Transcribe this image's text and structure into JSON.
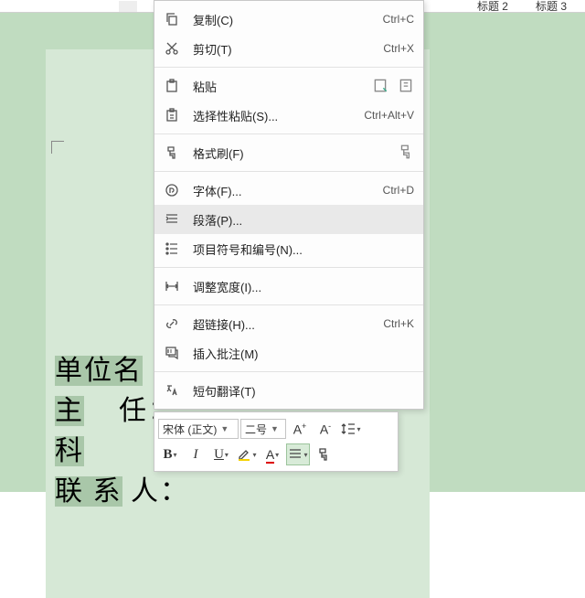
{
  "ribbon": {
    "styles": [
      "标题 2",
      "标题 3"
    ]
  },
  "document": {
    "lines": [
      {
        "highlighted": "单位名",
        "rest": ""
      },
      {
        "highlighted": "主",
        "rest": "    任："
      },
      {
        "highlighted": "科",
        "rest": ""
      },
      {
        "highlighted": "联 系",
        "rest": " 人："
      }
    ]
  },
  "contextMenu": {
    "items": [
      {
        "icon": "copy",
        "label": "复制(C)",
        "shortcut": "Ctrl+C"
      },
      {
        "icon": "cut",
        "label": "剪切(T)",
        "shortcut": "Ctrl+X"
      },
      {
        "sep": true
      },
      {
        "icon": "paste",
        "label": "粘贴",
        "shortcut": "",
        "rightIcons": [
          "paste-opt1",
          "paste-opt2"
        ]
      },
      {
        "icon": "paste-sp",
        "label": "选择性粘贴(S)...",
        "shortcut": "Ctrl+Alt+V"
      },
      {
        "sep": true
      },
      {
        "icon": "brush",
        "label": "格式刷(F)",
        "shortcut": "",
        "rightIcons": [
          "brush-alt"
        ]
      },
      {
        "sep": true
      },
      {
        "icon": "font",
        "label": "字体(F)...",
        "shortcut": "Ctrl+D"
      },
      {
        "icon": "para",
        "label": "段落(P)...",
        "shortcut": "",
        "hover": true
      },
      {
        "icon": "list",
        "label": "项目符号和编号(N)...",
        "shortcut": ""
      },
      {
        "sep": true
      },
      {
        "icon": "width",
        "label": "调整宽度(I)...",
        "shortcut": ""
      },
      {
        "sep": true
      },
      {
        "icon": "link",
        "label": "超链接(H)...",
        "shortcut": "Ctrl+K"
      },
      {
        "icon": "comment",
        "label": "插入批注(M)",
        "shortcut": ""
      },
      {
        "sep": true
      },
      {
        "icon": "trans",
        "label": "短句翻译(T)",
        "shortcut": ""
      }
    ]
  },
  "miniToolbar": {
    "font": "宋体 (正文)",
    "size": "二号",
    "buttons": {
      "growFont": "A⁺",
      "shrinkFont": "A⁻",
      "lineSpacing": "",
      "bold": "B",
      "italic": "I",
      "underline": "U",
      "highlight": "",
      "fontColor": "A",
      "align": "",
      "formatPainter": ""
    }
  }
}
